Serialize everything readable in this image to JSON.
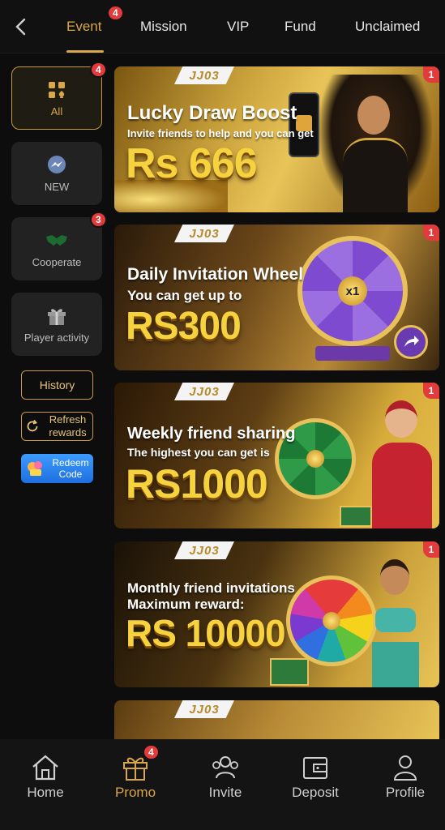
{
  "tabs": [
    {
      "label": "Event",
      "badge": "4"
    },
    {
      "label": "Mission"
    },
    {
      "label": "VIP"
    },
    {
      "label": "Fund"
    },
    {
      "label": "Unclaimed"
    }
  ],
  "sidebar": {
    "categories": [
      {
        "label": "All",
        "badge": "4",
        "icon": "grid-spade-icon"
      },
      {
        "label": "NEW",
        "icon": "messenger-icon"
      },
      {
        "label": "Cooperate",
        "badge": "3",
        "icon": "handshake-icon"
      },
      {
        "label": "Player activity",
        "icon": "gift-icon"
      }
    ],
    "history_label": "History",
    "refresh_label": "Refresh rewards",
    "redeem_label": "Redeem Code"
  },
  "banners": [
    {
      "logo": "JJ03",
      "title": "Lucky Draw Boost",
      "subtitle": "Invite friends to help and you can get",
      "amount": "Rs 666",
      "badge": "1"
    },
    {
      "logo": "JJ03",
      "title": "Daily Invitation Wheel",
      "subtitle": "You can get up to",
      "amount": "RS300",
      "badge": "1",
      "wheel_center": "x1"
    },
    {
      "logo": "JJ03",
      "title": "Weekly friend sharing",
      "subtitle": "The highest you can get is",
      "amount": "RS1000",
      "badge": "1"
    },
    {
      "logo": "JJ03",
      "title": "Monthly friend invitations",
      "subtitle": "Maximum reward:",
      "amount": "RS 10000",
      "badge": "1"
    },
    {
      "logo": "JJ03"
    }
  ],
  "bottom_nav": [
    {
      "label": "Home",
      "icon": "home-icon"
    },
    {
      "label": "Promo",
      "icon": "gift-icon",
      "badge": "4"
    },
    {
      "label": "Invite",
      "icon": "people-icon"
    },
    {
      "label": "Deposit",
      "icon": "wallet-icon"
    },
    {
      "label": "Profile",
      "icon": "person-icon"
    }
  ],
  "colors": {
    "accent": "#d9a64a",
    "badge": "#e23b3b",
    "amount": "#f7d23f"
  }
}
